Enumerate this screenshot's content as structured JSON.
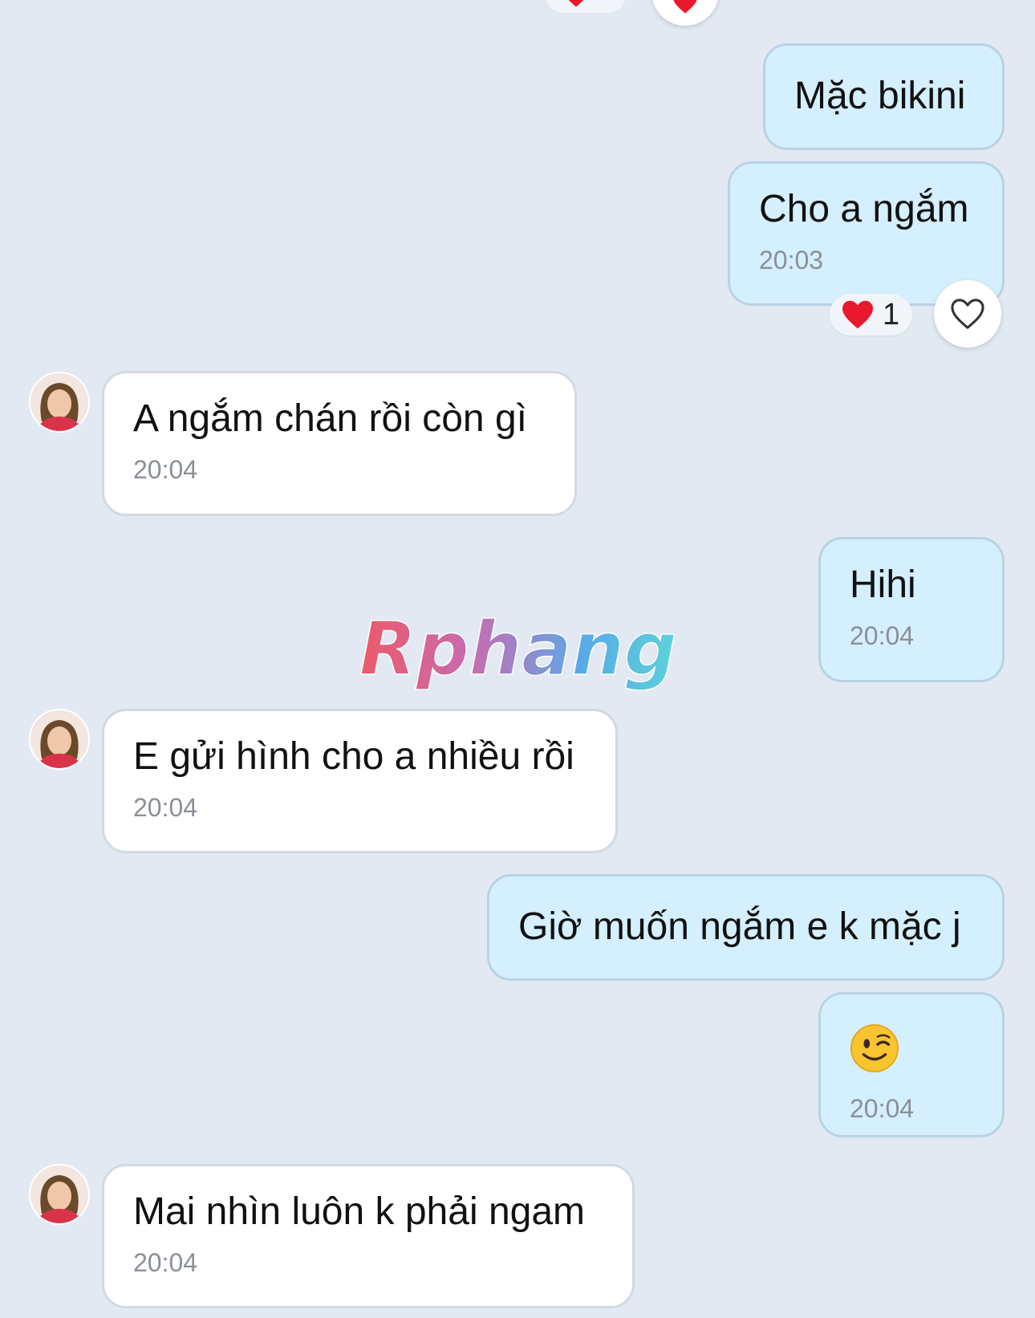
{
  "messages": [
    {
      "id": "m1",
      "direction": "out",
      "text": "Mặc bikini",
      "time": ""
    },
    {
      "id": "m2",
      "direction": "out",
      "text": "Cho a ngắm",
      "time": "20:03",
      "reaction": {
        "emoji": "heart",
        "count": "1"
      }
    },
    {
      "id": "m3",
      "direction": "in",
      "text": "A ngắm chán rồi còn gì",
      "time": "20:04"
    },
    {
      "id": "m4",
      "direction": "out",
      "text": "Hihi",
      "time": "20:04"
    },
    {
      "id": "m5",
      "direction": "in",
      "text": "E gửi hình cho a nhiều rồi",
      "time": "20:04"
    },
    {
      "id": "m6",
      "direction": "out",
      "text": "Giờ muốn ngắm e k mặc j",
      "time": ""
    },
    {
      "id": "m7",
      "direction": "out",
      "text": "",
      "emoji": "winking-face",
      "time": "20:04"
    },
    {
      "id": "m8",
      "direction": "in",
      "text": "Mai nhìn luôn k phải ngam",
      "time": "20:04"
    }
  ],
  "watermark": {
    "text": "Rphang"
  },
  "colors": {
    "background": "#e2e9f3",
    "outgoing_bubble": "#d4effd",
    "incoming_bubble": "#ffffff",
    "timestamp": "#8a9097",
    "heart": "#e8192c"
  }
}
